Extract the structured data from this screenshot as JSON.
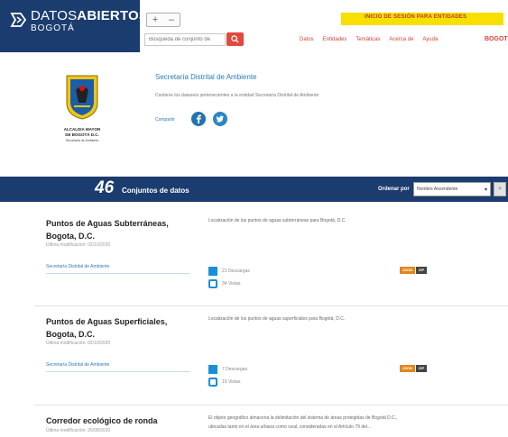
{
  "header": {
    "brand_light": "DATOS",
    "brand_bold": "ABIERTOS",
    "brand_city": "BOGOTÁ",
    "zoom_minus": "+",
    "zoom_plus": "–",
    "login_link": "INICIO DE SESIÓN PARA ENTIDADES",
    "search_placeholder": "Búsqueda de conjunto de",
    "nav": [
      "Datos",
      "Entidades",
      "Temáticas",
      "Acerca de",
      "Ayuda"
    ],
    "nav_brand": "BOGOT",
    "icons": {
      "brand": "bogota-logo-icon",
      "search": "search-icon"
    }
  },
  "entity": {
    "logo_caption_1": "ALCALDIA MAYOR",
    "logo_caption_2": "DE BOGOTÁ D.C.",
    "logo_caption_3": "Secretaría de Ambiente",
    "title": "Secretaría Distrital de Ambiente",
    "description": "Contiene los datasets pertenecientes a la entidad Secretaría Distrital de Ambiente",
    "share_label": "Compartir",
    "social_icons": [
      "facebook-icon",
      "twitter-icon"
    ]
  },
  "datasets_bar": {
    "count": "46",
    "count_label": "Conjuntos de datos",
    "sort_label": "Ordenar por",
    "sort_value": "Nombre Ascendente",
    "sort_button": ">"
  },
  "datasets": [
    {
      "title": "Puntos de Aguas Subterráneas, Bogota, D.C.",
      "modified": "Última modificación: 02/10/2020",
      "organization": "Secretaría Distrital de Ambiente",
      "description": "Localización de los puntos de aguas subterráneas para Bogotá, D.C.",
      "downloads": "21 Descargas",
      "views": "34 Vistas",
      "formats": [
        "JSON",
        "ZIP"
      ]
    },
    {
      "title": "Puntos de Aguas Superficiales, Bogota, D.C.",
      "modified": "Última modificación: 02/10/2020",
      "organization": "Secretaría Distrital de Ambiente",
      "description": "Localización de los puntos de aguas superficiales para Bogotá, D.C.",
      "downloads": "7 Descargas",
      "views": "19 Vistas",
      "formats": [
        "JSON",
        "ZIP"
      ]
    },
    {
      "title": "Corredor ecológico de ronda",
      "modified": "Última modificación: 25/09/2020",
      "description_1": "El objeto geográfico almacena la delimitación del sistema de áreas protegidas de Bogotá D.C.,",
      "description_2": "ubicadas tanto en el área urbana como rural, consideradas en el Artículo 79 del..."
    }
  ],
  "colors": {
    "primary": "#1b3c6e",
    "accent": "#d1443a",
    "link": "#2a7bb8",
    "login_strip": "#f7e000"
  }
}
